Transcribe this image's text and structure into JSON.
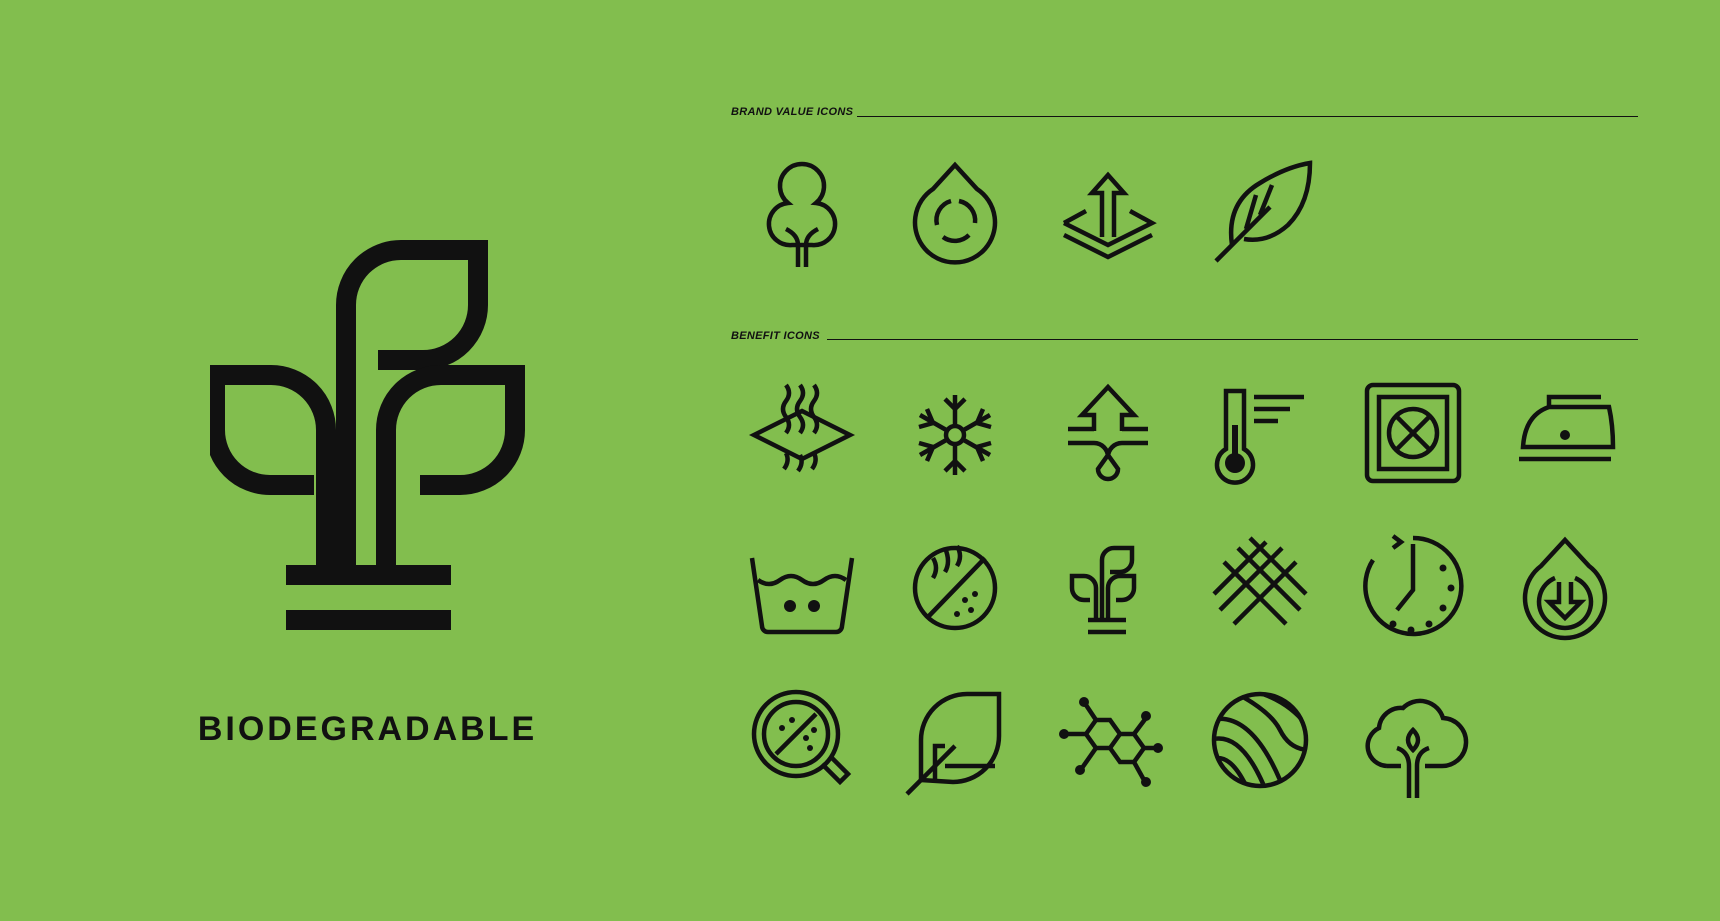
{
  "hero": {
    "icon": "biodegradable-sprout-icon",
    "title": "BIODEGRADABLE"
  },
  "sections": {
    "brand_values": {
      "label": "BRAND VALUE ICONS",
      "icons": [
        "tree-icon",
        "water-recycle-drop-icon",
        "breathable-layer-icon",
        "lightweight-feather-icon"
      ]
    },
    "benefits": {
      "label": "BENEFIT ICONS",
      "icons": [
        "heat-release-icon",
        "snowflake-icon",
        "moisture-wicking-icon",
        "thermometer-icon",
        "do-not-tumble-dry-icon",
        "iron-icon",
        "machine-wash-icon",
        "anti-odor-icon",
        "sprout-icon",
        "woven-fabric-icon",
        "quick-dry-clock-icon",
        "water-absorb-drop-icon",
        "antibacterial-magnifier-icon",
        "leaf-icon",
        "molecule-icon",
        "textured-ball-icon",
        "cotton-tree-icon"
      ]
    }
  },
  "colors": {
    "background": "#82be4e",
    "ink": "#111111"
  }
}
